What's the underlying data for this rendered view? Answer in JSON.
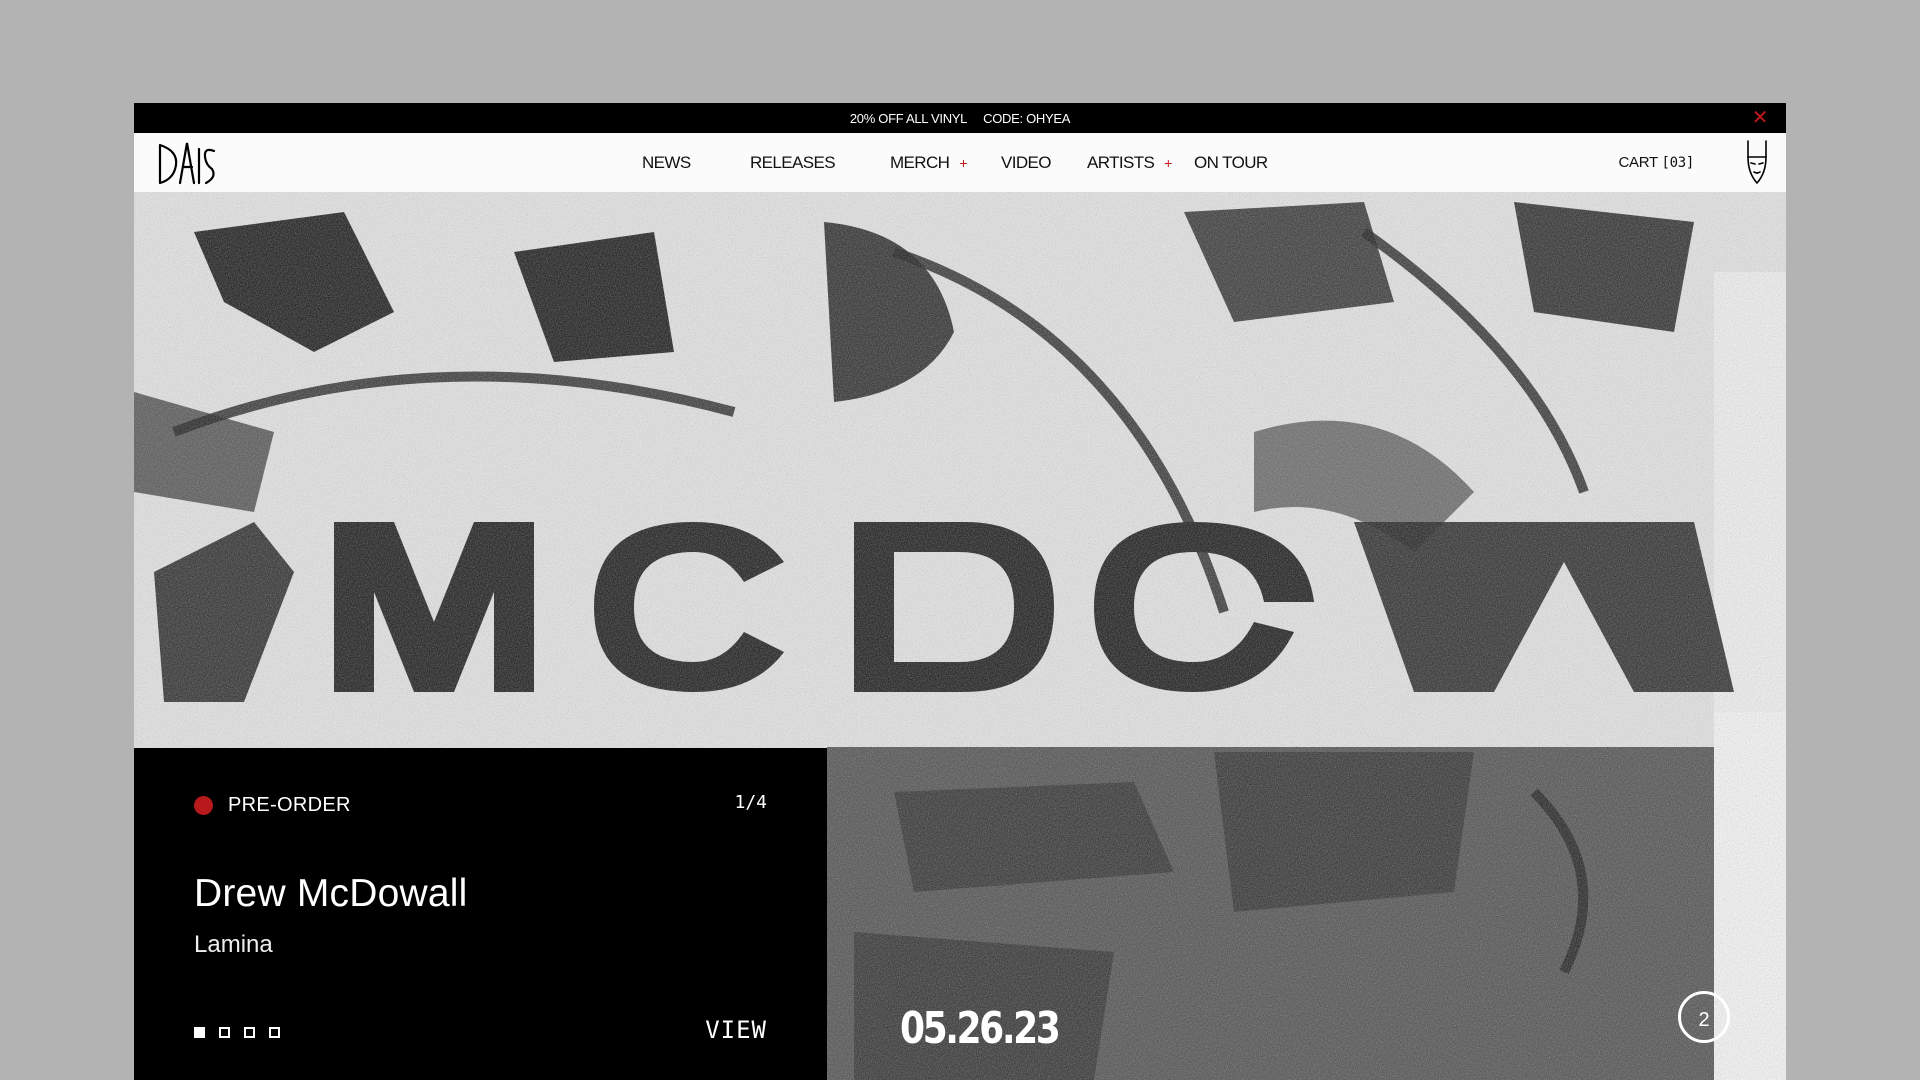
{
  "promo": {
    "offer": "20% OFF ALL VINYL",
    "code": "CODE: OHYEA",
    "close_icon": "close-icon"
  },
  "nav": {
    "logo_text": "DAIS",
    "items": [
      {
        "label": "NEWS",
        "has_plus": false
      },
      {
        "label": "RELEASES",
        "has_plus": false
      },
      {
        "label": "MERCH",
        "has_plus": true
      },
      {
        "label": "VIDEO",
        "has_plus": false
      },
      {
        "label": "ARTISTS",
        "has_plus": true
      },
      {
        "label": "ON TOUR",
        "has_plus": false
      }
    ],
    "plus_symbol": "+",
    "cart_label": "CART",
    "cart_count": "[03]",
    "mascot_icon": "mascot-icon"
  },
  "hero": {
    "status": "PRE-ORDER",
    "counter": "1/4",
    "artist": "Drew McDowall",
    "album": "Lamina",
    "view_label": "VIEW",
    "date": "05.26.23",
    "badge": "2",
    "slides_total": 4,
    "active_slide": 1
  },
  "colors": {
    "accent_red": "#b7191d",
    "black": "#000000",
    "page_bg": "#b3b3b3"
  }
}
